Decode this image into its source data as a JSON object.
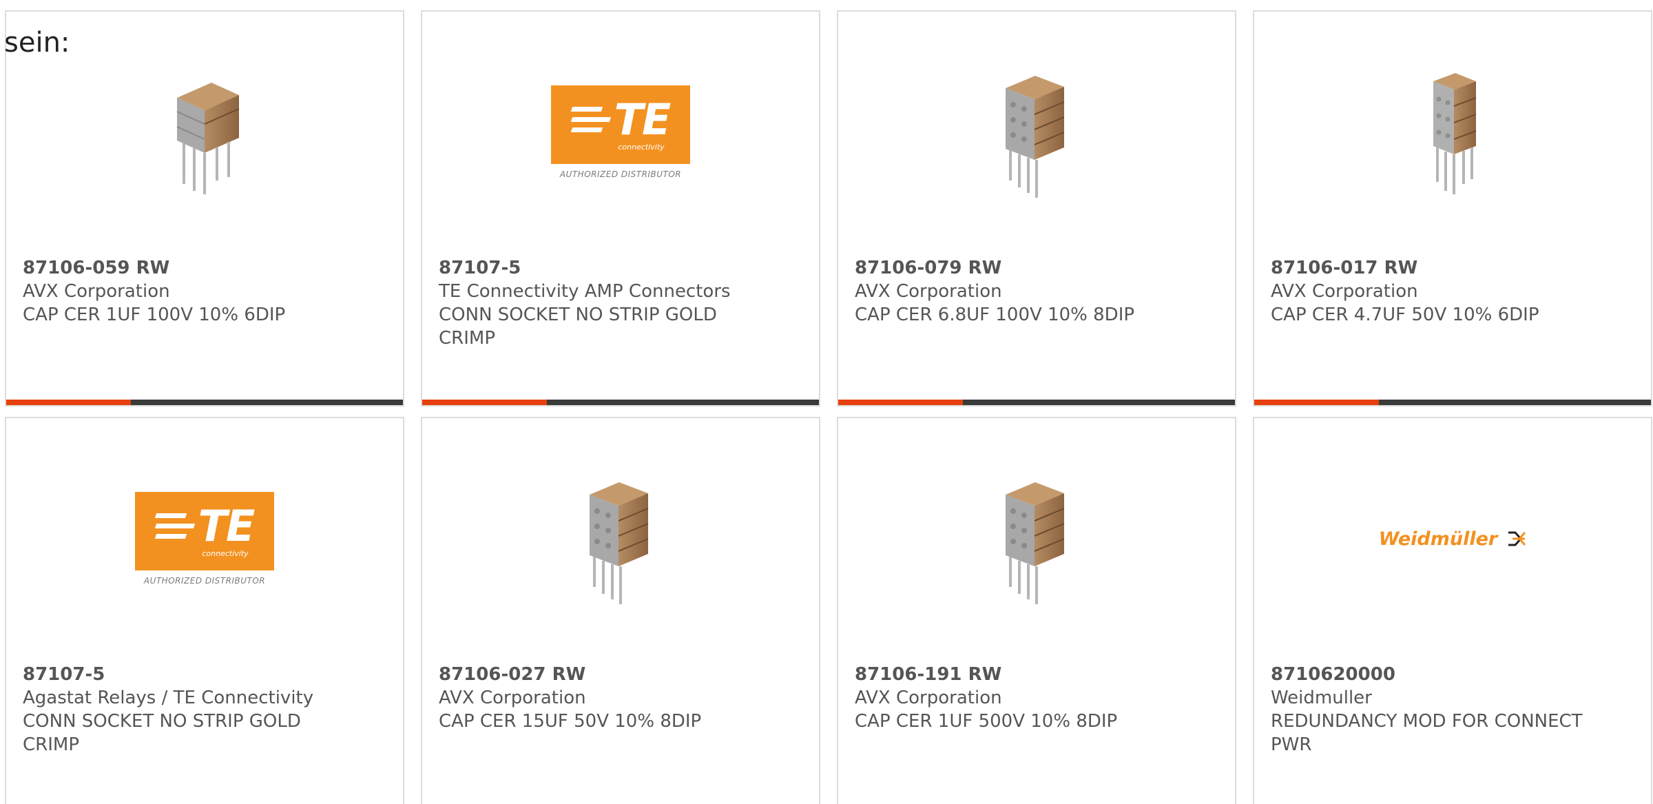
{
  "intro_text": "sein:",
  "colors": {
    "accent": "#e8400c",
    "bar": "#3a3a3a",
    "te_orange": "#f39120",
    "weidmuller_orange": "#f39120",
    "text": "#555555",
    "border": "#dcdcdc"
  },
  "products": [
    {
      "part_number": "87106-059 RW",
      "manufacturer": "AVX Corporation",
      "description": "CAP CER 1UF 100V 10% 6DIP",
      "image": "capacitor-6dip-icon"
    },
    {
      "part_number": "87107-5",
      "manufacturer": "TE Connectivity AMP Connectors",
      "description": "CONN SOCKET NO STRIP GOLD CRIMP",
      "image": "te-connectivity-logo"
    },
    {
      "part_number": "87106-079 RW",
      "manufacturer": "AVX Corporation",
      "description": "CAP CER 6.8UF 100V 10% 8DIP",
      "image": "capacitor-8dip-icon"
    },
    {
      "part_number": "87106-017 RW",
      "manufacturer": "AVX Corporation",
      "description": "CAP CER 4.7UF 50V 10% 6DIP",
      "image": "capacitor-tall-icon"
    },
    {
      "part_number": "87107-5",
      "manufacturer": "Agastat Relays / TE Connectivity",
      "description": "CONN SOCKET NO STRIP GOLD CRIMP",
      "image": "te-connectivity-logo"
    },
    {
      "part_number": "87106-027 RW",
      "manufacturer": "AVX Corporation",
      "description": "CAP CER 15UF 50V 10% 8DIP",
      "image": "capacitor-8dip-icon"
    },
    {
      "part_number": "87106-191 RW",
      "manufacturer": "AVX Corporation",
      "description": "CAP CER 1UF 500V 10% 8DIP",
      "image": "capacitor-8dip-icon"
    },
    {
      "part_number": "8710620000",
      "manufacturer": "Weidmuller",
      "description": "REDUNDANCY MOD FOR CONNECT PWR",
      "image": "weidmuller-logo"
    }
  ],
  "te_logo": {
    "mark": "TE",
    "sub": "connectivity",
    "caption": "AUTHORIZED DISTRIBUTOR"
  },
  "weidmuller_logo": {
    "text": "Weidmüller"
  }
}
